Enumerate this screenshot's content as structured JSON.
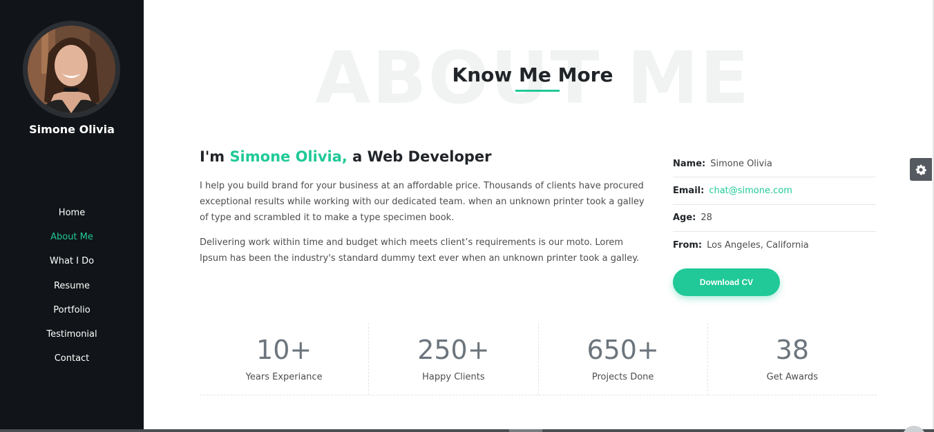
{
  "sidebar": {
    "name": "Simone Olivia",
    "nav": [
      {
        "label": "Home",
        "active": false
      },
      {
        "label": "About Me",
        "active": true
      },
      {
        "label": "What I Do",
        "active": false
      },
      {
        "label": "Resume",
        "active": false
      },
      {
        "label": "Portfolio",
        "active": false
      },
      {
        "label": "Testimonial",
        "active": false
      },
      {
        "label": "Contact",
        "active": false
      }
    ]
  },
  "about": {
    "watermark": "ABOUT ME",
    "title": "Know Me More",
    "intro_prefix": "I'm ",
    "intro_name": "Simone Olivia,",
    "intro_suffix": " a Web Developer",
    "paragraph1": "I help you build brand for your business at an affordable price. Thousands of clients have procured exceptional results while working with our dedicated team. when an unknown printer took a galley of type and scrambled it to make a type specimen book.",
    "paragraph2": "Delivering work within time and budget which meets client’s requirements is our moto. Lorem Ipsum has been the industry's standard dummy text ever when an unknown printer took a galley."
  },
  "info": [
    {
      "label": "Name:",
      "value": "Simone Olivia"
    },
    {
      "label": "Email:",
      "value": "chat@simone.com"
    },
    {
      "label": "Age:",
      "value": "28"
    },
    {
      "label": "From:",
      "value": "Los Angeles, California"
    }
  ],
  "download_label": "Download CV",
  "stats": [
    {
      "value": "10+",
      "label": "Years Experiance"
    },
    {
      "value": "250+",
      "label": "Happy Clients"
    },
    {
      "value": "650+",
      "label": "Projects Done"
    },
    {
      "value": "38",
      "label": "Get Awards"
    }
  ],
  "colors": {
    "accent": "#20c997",
    "sidebar_bg": "#111418",
    "heading": "#212529"
  },
  "icons": {
    "settings": "gear-icon"
  }
}
